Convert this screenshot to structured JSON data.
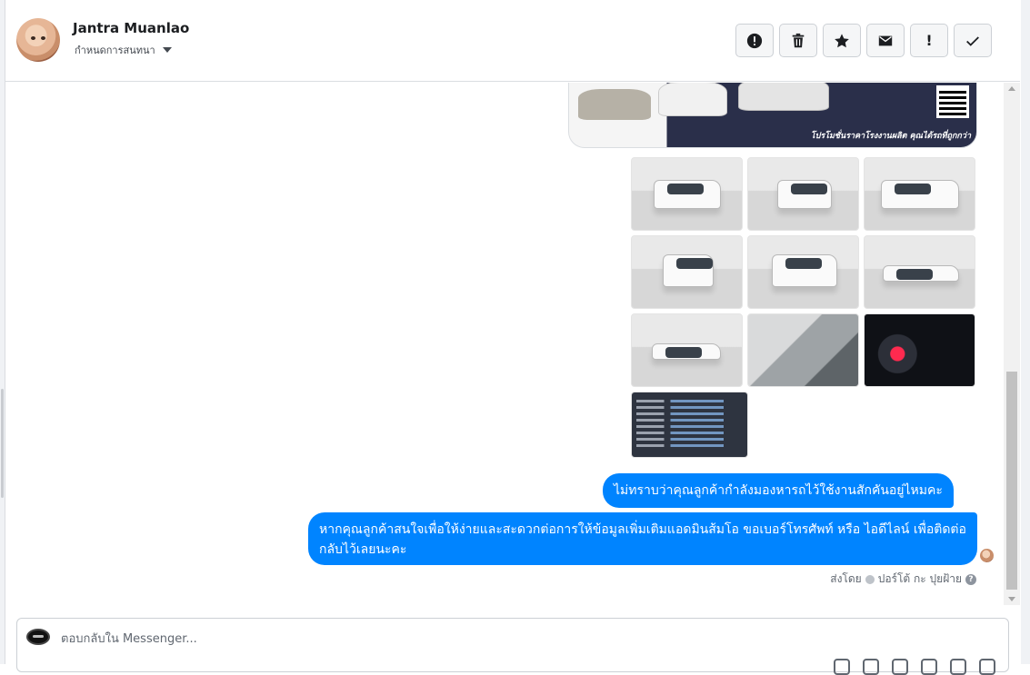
{
  "contact": {
    "name": "Jantra Muanlao",
    "assign_label": "กำหนดการสนทนา"
  },
  "toolbar": {
    "buttons": [
      {
        "name": "spam-button",
        "icon": "alert-circle-icon"
      },
      {
        "name": "delete-button",
        "icon": "trash-icon"
      },
      {
        "name": "star-button",
        "icon": "star-icon"
      },
      {
        "name": "mark-unread-button",
        "icon": "envelope-icon"
      },
      {
        "name": "important-button",
        "icon": "exclamation-icon",
        "glyph": "!"
      },
      {
        "name": "done-button",
        "icon": "checkmark-icon"
      }
    ]
  },
  "banner": {
    "promo_text": "โปรโมชั่นราคาโรงงานผลิต คุณได้รถที่ถูกกว่า"
  },
  "photos": [
    {
      "kind": "front-left"
    },
    {
      "kind": "front"
    },
    {
      "kind": "rear-left"
    },
    {
      "kind": "rear"
    },
    {
      "kind": "rear-right"
    },
    {
      "kind": "side"
    },
    {
      "kind": "side-wide"
    },
    {
      "kind": "interior"
    },
    {
      "kind": "dashboard"
    },
    {
      "kind": "spec-sheet"
    }
  ],
  "messages": [
    {
      "id": "msg1",
      "text": "ไม่ทราบว่าคุณลูกค้ากำลังมองหารถไว้ใช้งานสักคันอยู่ไหมคะ"
    },
    {
      "id": "msg2",
      "text": "หากคุณลูกค้าสนใจเพื่อให้ง่ายและสะดวกต่อการให้ข้อมูลเพิ่มเติมแอดมินส้มโอ ขอเบอร์โทรศัพท์ หรือ ไอดีไลน์ เพื่อติดต่อกลับไว้เลยนะคะ"
    }
  ],
  "sent_by": {
    "prefix": "ส่งโดย",
    "author": "ปอร์โต้ กะ ปุยฝ้าย",
    "help": "?"
  },
  "composer": {
    "placeholder": "ตอบกลับใน Messenger..."
  },
  "colors": {
    "accent": "#0084ff",
    "border": "#dadde1"
  }
}
